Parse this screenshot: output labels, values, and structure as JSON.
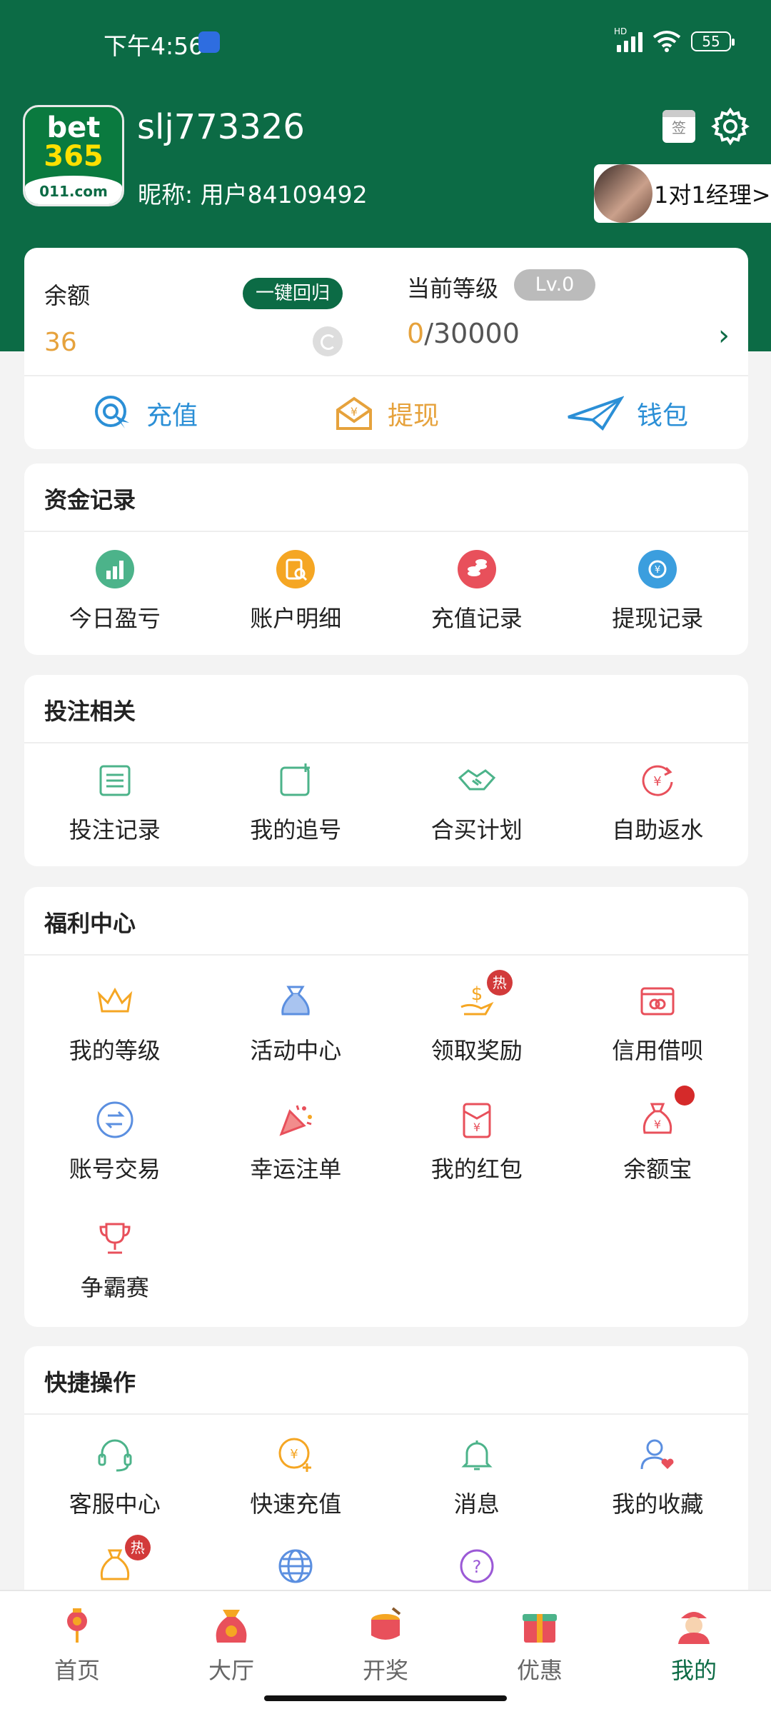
{
  "status_bar": {
    "time": "下午4:56",
    "network": "HD",
    "battery": "55"
  },
  "profile": {
    "username": "slj773326",
    "nickname": "昵称: 用户84109492",
    "logo": {
      "line1": "bet",
      "line2": "365",
      "line3": "011.com"
    },
    "sign_label": "签",
    "manager_label": "1对1经理>"
  },
  "balance": {
    "label": "余额",
    "value": "36",
    "recall_label": "一键回归",
    "level_label": "当前等级",
    "level_badge": "Lv.0",
    "progress_current": "0",
    "progress_total": "/30000"
  },
  "quick_actions": [
    {
      "label": "充值",
      "icon": "recharge-icon",
      "color": "#2b8fd6"
    },
    {
      "label": "提现",
      "icon": "withdraw-icon",
      "color": "#e6a23c"
    },
    {
      "label": "钱包",
      "icon": "wallet-icon",
      "color": "#2b8fd6"
    }
  ],
  "funds": {
    "title": "资金记录",
    "items": [
      {
        "label": "今日盈亏",
        "icon": "chart-icon"
      },
      {
        "label": "账户明细",
        "icon": "account-detail-icon"
      },
      {
        "label": "充值记录",
        "icon": "coins-icon"
      },
      {
        "label": "提现记录",
        "icon": "withdraw-record-icon"
      }
    ]
  },
  "betting": {
    "title": "投注相关",
    "items": [
      {
        "label": "投注记录",
        "icon": "list-icon"
      },
      {
        "label": "我的追号",
        "icon": "add-note-icon"
      },
      {
        "label": "合买计划",
        "icon": "handshake-icon"
      },
      {
        "label": "自助返水",
        "icon": "rebate-icon"
      }
    ]
  },
  "welfare": {
    "title": "福利中心",
    "items": [
      {
        "label": "我的等级",
        "icon": "crown-icon"
      },
      {
        "label": "活动中心",
        "icon": "gift-bag-icon"
      },
      {
        "label": "领取奖励",
        "icon": "reward-icon",
        "badge": "热"
      },
      {
        "label": "信用借呗",
        "icon": "credit-card-icon"
      },
      {
        "label": "账号交易",
        "icon": "exchange-icon"
      },
      {
        "label": "幸运注单",
        "icon": "party-popper-icon"
      },
      {
        "label": "我的红包",
        "icon": "red-envelope-icon"
      },
      {
        "label": "余额宝",
        "icon": "money-bag-icon",
        "dot": true
      },
      {
        "label": "争霸赛",
        "icon": "trophy-icon"
      }
    ]
  },
  "shortcuts": {
    "title": "快捷操作",
    "items": [
      {
        "label": "客服中心",
        "icon": "headset-icon"
      },
      {
        "label": "快速充值",
        "icon": "quick-recharge-icon"
      },
      {
        "label": "消息",
        "icon": "bell-icon"
      },
      {
        "label": "我的收藏",
        "icon": "favorite-user-icon"
      }
    ],
    "partial_badge": "热"
  },
  "tabbar": [
    {
      "label": "首页",
      "icon": "home-lantern-icon"
    },
    {
      "label": "大厅",
      "icon": "lobby-icon"
    },
    {
      "label": "开奖",
      "icon": "lottery-drum-icon"
    },
    {
      "label": "优惠",
      "icon": "promo-gift-icon"
    },
    {
      "label": "我的",
      "icon": "profile-icon",
      "active": true
    }
  ],
  "colors": {
    "brand": "#0c6b45",
    "accent": "#e6a23c",
    "hot": "#d23a3a"
  }
}
